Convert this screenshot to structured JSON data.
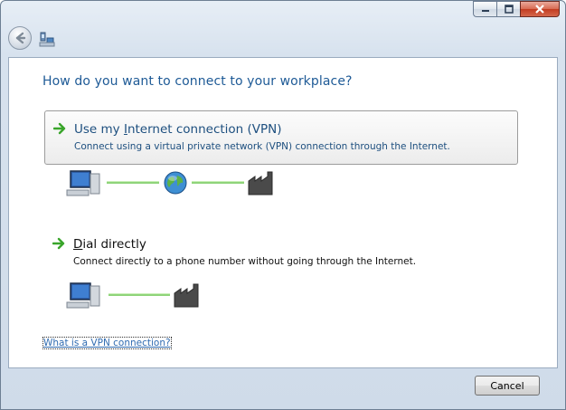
{
  "window": {
    "caption": {
      "minimize": "minimize",
      "maximize": "maximize",
      "close": "close"
    }
  },
  "nav": {
    "back_icon": "back-arrow-icon",
    "wizard_icon": "network-connection-icon"
  },
  "main": {
    "title": "How do you want to connect to your workplace?",
    "options": [
      {
        "title": "Use my Internet connection (VPN)",
        "title_access_key": "I",
        "description": "Connect using a virtual private network (VPN) connection through the Internet.",
        "selected": true
      },
      {
        "title": "Dial directly",
        "title_access_key": "D",
        "description": "Connect directly to a phone number without going through the Internet.",
        "selected": false
      }
    ],
    "help_link": "What is a VPN connection?"
  },
  "footer": {
    "cancel_label": "Cancel"
  },
  "colors": {
    "title_blue": "#1e5a96",
    "link_blue": "#2f6bb1",
    "arrow_green": "#3aa52b"
  }
}
